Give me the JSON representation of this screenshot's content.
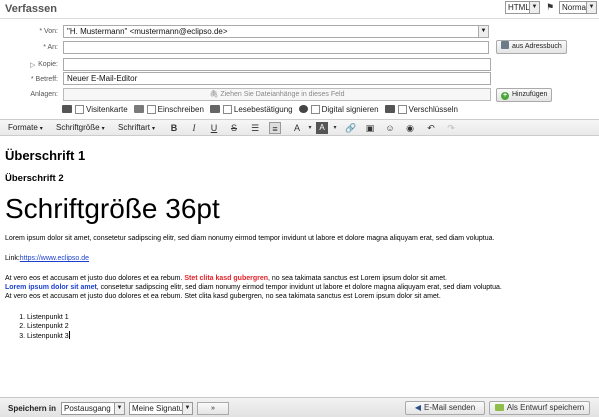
{
  "window": {
    "title": "Verfassen"
  },
  "format_select": {
    "value": "HTML"
  },
  "priority_select": {
    "value": "Normal"
  },
  "fields": {
    "from": {
      "label": "* Von:",
      "value": "\"H. Mustermann\" <mustermann@eclipso.de>"
    },
    "to": {
      "label": "* An:",
      "value": ""
    },
    "cc": {
      "label": "Kopie:",
      "value": ""
    },
    "subject": {
      "label": "* Betreff:",
      "value": "Neuer E-Mail-Editor"
    },
    "attachments": {
      "label": "Anlagen:",
      "dropzone": "Ziehen Sie Dateianhänge in dieses Feld"
    }
  },
  "buttons": {
    "address_book": "aus Adressbuch",
    "add_attachment": "Hinzufügen"
  },
  "options": [
    {
      "label": "Visitenkarte"
    },
    {
      "label": "Einschreiben"
    },
    {
      "label": "Lesebestätigung"
    },
    {
      "label": "Digital signieren"
    },
    {
      "label": "Verschlüsseln"
    }
  ],
  "toolbar": {
    "format": "Formate",
    "size": "Schriftgröße",
    "font": "Schriftart"
  },
  "editor": {
    "h1": "Überschrift 1",
    "h2": "Überschrift 2",
    "big": "Schriftgröße 36pt",
    "para1": "Lorem ipsum dolor sit amet, consetetur sadipscing elitr, sed diam nonumy eirmod tempor invidunt ut labore et dolore magna aliquyam erat, sed diam voluptua.",
    "link_label": "Link:",
    "link_url": "https://www.eclipso.de",
    "l1_a": "At vero eos et accusam et justo duo dolores et ea rebum. ",
    "l1_red": "Stet clita kasd gubergren",
    "l1_b": ", no sea takimata sanctus est Lorem ipsum dolor sit amet.",
    "l2_blue": "Lorem ipsum dolor sit amet",
    "l2_b": ", consetetur sadipscing elitr, sed diam nonumy eirmod tempor invidunt ut labore et dolore magna aliquyam erat, sed diam voluptua.",
    "l3": "At vero eos et accusam et justo duo dolores et ea rebum. Stet clita kasd gubergren, no sea takimata sanctus est Lorem ipsum dolor sit amet.",
    "list": [
      "Listenpunkt 1",
      "Listenpunkt 2",
      "Listenpunkt 3"
    ]
  },
  "footer": {
    "save_in": "Speichern in",
    "folder": "Postausgang",
    "signature": "Meine Signatur",
    "more": "»",
    "send": "E-Mail senden",
    "draft": "Als Entwurf speichern"
  },
  "colors": {
    "link": "#1a3fcf",
    "highlight_red": "#e0222a",
    "highlight_blue": "#1a3fcf"
  }
}
